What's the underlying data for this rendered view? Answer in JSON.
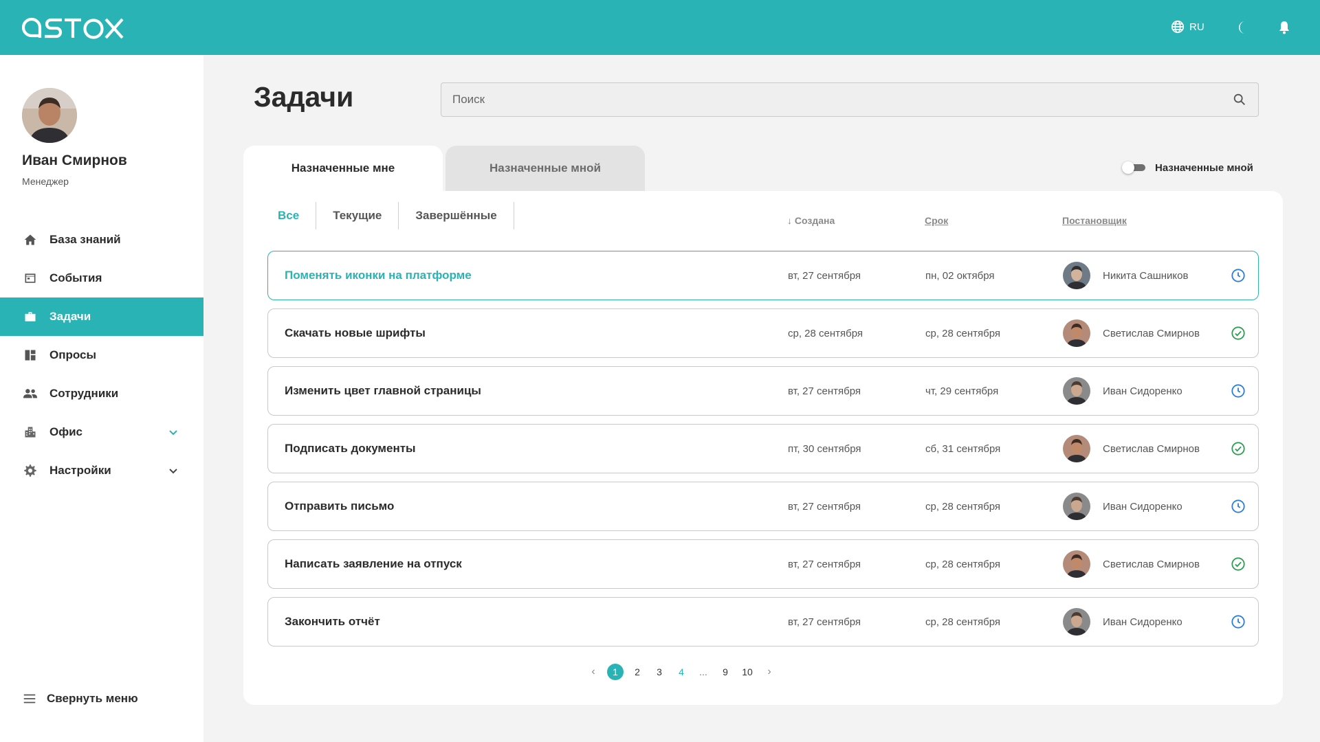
{
  "header": {
    "logo": "astox",
    "language": "RU"
  },
  "colors": {
    "accent": "#2ab3b5",
    "done": "#2e9e52",
    "pending": "#2a7fd8"
  },
  "user": {
    "name": "Иван Смирнов",
    "role": "Менеджер"
  },
  "sidebar": {
    "items": [
      {
        "label": "База знаний",
        "icon": "home-icon"
      },
      {
        "label": "События",
        "icon": "calendar-table-icon"
      },
      {
        "label": "Задачи",
        "icon": "briefcase-icon",
        "active": true
      },
      {
        "label": "Опросы",
        "icon": "dashboard-icon"
      },
      {
        "label": "Сотрудники",
        "icon": "people-icon"
      },
      {
        "label": "Офис",
        "icon": "building-icon",
        "expandable": true
      },
      {
        "label": "Настройки",
        "icon": "gear-icon",
        "expandable": true
      }
    ],
    "collapse_label": "Свернуть меню"
  },
  "main": {
    "title": "Задачи",
    "search_placeholder": "Поиск",
    "tabs": [
      {
        "label": "Назначенные мне",
        "active": true
      },
      {
        "label": "Назначенные мной",
        "active": false
      }
    ],
    "toggle_label": "Назначенные мной",
    "toggle_on": false,
    "filters": [
      {
        "label": "Все",
        "active": true
      },
      {
        "label": "Текущие",
        "active": false
      },
      {
        "label": "Завершённые",
        "active": false
      }
    ],
    "columns": {
      "created": "↓ Создана",
      "due": "Срок",
      "assigner": "Постановщик"
    },
    "tasks": [
      {
        "title": "Поменять иконки на платформе",
        "created": "вт, 27 сентября",
        "due": "пн, 02 октября",
        "assigner": "Никита Сашников",
        "status": "pending",
        "selected": true
      },
      {
        "title": "Скачать новые шрифты",
        "created": "ср, 28 сентября",
        "due": "ср, 28 сентября",
        "assigner": "Светислав Смирнов",
        "status": "done"
      },
      {
        "title": "Изменить цвет главной страницы",
        "created": "вт, 27 сентября",
        "due": "чт, 29 сентября",
        "assigner": "Иван Сидоренко",
        "status": "pending"
      },
      {
        "title": "Подписать документы",
        "created": "пт, 30 сентября",
        "due": "сб, 31 сентября",
        "assigner": "Светислав Смирнов",
        "status": "done"
      },
      {
        "title": "Отправить письмо",
        "created": "вт, 27 сентября",
        "due": "ср, 28 сентября",
        "assigner": "Иван Сидоренко",
        "status": "pending"
      },
      {
        "title": "Написать заявление на отпуск",
        "created": "вт, 27 сентября",
        "due": "ср, 28 сентября",
        "assigner": "Светислав Смирнов",
        "status": "done"
      },
      {
        "title": "Закончить отчёт",
        "created": "вт, 27 сентября",
        "due": "ср, 28 сентября",
        "assigner": "Иван Сидоренко",
        "status": "pending"
      }
    ],
    "pagination": {
      "prev": "‹",
      "next": "›",
      "pages": [
        "1",
        "2",
        "3",
        "4",
        "...",
        "9",
        "10"
      ],
      "current": "1"
    }
  }
}
